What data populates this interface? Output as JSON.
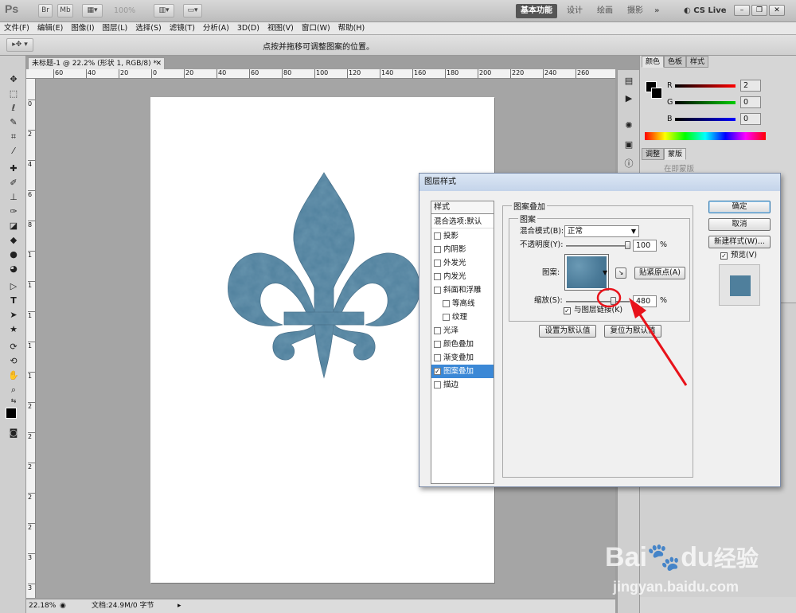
{
  "app": {
    "logo": "Ps",
    "zoom_display": "100%",
    "workspaces": [
      "基本功能",
      "设计",
      "绘画",
      "摄影"
    ],
    "more_workspaces": "»",
    "cs_live": "CS Live"
  },
  "menu": [
    "文件(F)",
    "编辑(E)",
    "图像(I)",
    "图层(L)",
    "选择(S)",
    "滤镜(T)",
    "分析(A)",
    "3D(D)",
    "视图(V)",
    "窗口(W)",
    "帮助(H)"
  ],
  "options_bar": {
    "hint": "点按并拖移可调整图案的位置。"
  },
  "document": {
    "tab_title": "未标题-1 @ 22.2% (形状 1, RGB/8) *",
    "ruler_top": [
      "60",
      "40",
      "20",
      "0",
      "20",
      "40",
      "60",
      "80",
      "100",
      "120",
      "140",
      "160",
      "180",
      "200",
      "220",
      "240",
      "260"
    ],
    "ruler_left": [
      "0",
      "2",
      "4",
      "6",
      "8",
      "1",
      "1",
      "1",
      "1",
      "1",
      "2",
      "2",
      "2",
      "2",
      "2",
      "3",
      "3"
    ],
    "status_zoom": "22.18%",
    "status_doc": "文档:24.9M/0 字节"
  },
  "panels": {
    "top_tabs": [
      "颜色",
      "色板",
      "样式"
    ],
    "color_rows": [
      {
        "label": "R",
        "value": "2"
      },
      {
        "label": "G",
        "value": "0"
      },
      {
        "label": "B",
        "value": "0"
      }
    ],
    "mid_tabs": [
      "调整",
      "蒙版"
    ],
    "mid_text": "在即蒙版"
  },
  "dialog": {
    "title": "图层样式",
    "style_list_header": "样式",
    "blend_options": "混合选项:默认",
    "styles": [
      {
        "label": "投影",
        "checked": false,
        "indent": false
      },
      {
        "label": "内阴影",
        "checked": false,
        "indent": false
      },
      {
        "label": "外发光",
        "checked": false,
        "indent": false
      },
      {
        "label": "内发光",
        "checked": false,
        "indent": false
      },
      {
        "label": "斜面和浮雕",
        "checked": false,
        "indent": false
      },
      {
        "label": "等高线",
        "checked": false,
        "indent": true
      },
      {
        "label": "纹理",
        "checked": false,
        "indent": true
      },
      {
        "label": "光泽",
        "checked": false,
        "indent": false
      },
      {
        "label": "颜色叠加",
        "checked": false,
        "indent": false
      },
      {
        "label": "渐变叠加",
        "checked": false,
        "indent": false
      },
      {
        "label": "图案叠加",
        "checked": true,
        "indent": false,
        "selected": true
      },
      {
        "label": "描边",
        "checked": false,
        "indent": false
      }
    ],
    "section_title": "图案叠加",
    "group_title": "图案",
    "blend_mode_label": "混合模式(B):",
    "blend_mode_value": "正常",
    "opacity_label": "不透明度(Y):",
    "opacity_value": "100",
    "opacity_unit": "%",
    "pattern_label": "图案:",
    "snap_origin": "贴紧原点(A)",
    "scale_label": "缩放(S):",
    "scale_value": "480",
    "scale_unit": "%",
    "scale_fraction": 0.74,
    "link_label": "与图层链接(K)",
    "link_checked": "✓",
    "make_default": "设置为默认值",
    "reset_default": "复位为默认值",
    "ok": "确定",
    "cancel": "取消",
    "new_style": "新建样式(W)...",
    "preview_label": "预览(V)",
    "preview_checked": "✓"
  },
  "colors": {
    "pattern_blue": "#4f7f9c",
    "annotation_red": "#e8121a"
  },
  "watermark": {
    "brand": "Bai",
    "brand2": "du",
    "cn": "经验",
    "url": "jingyan.baidu.com"
  }
}
